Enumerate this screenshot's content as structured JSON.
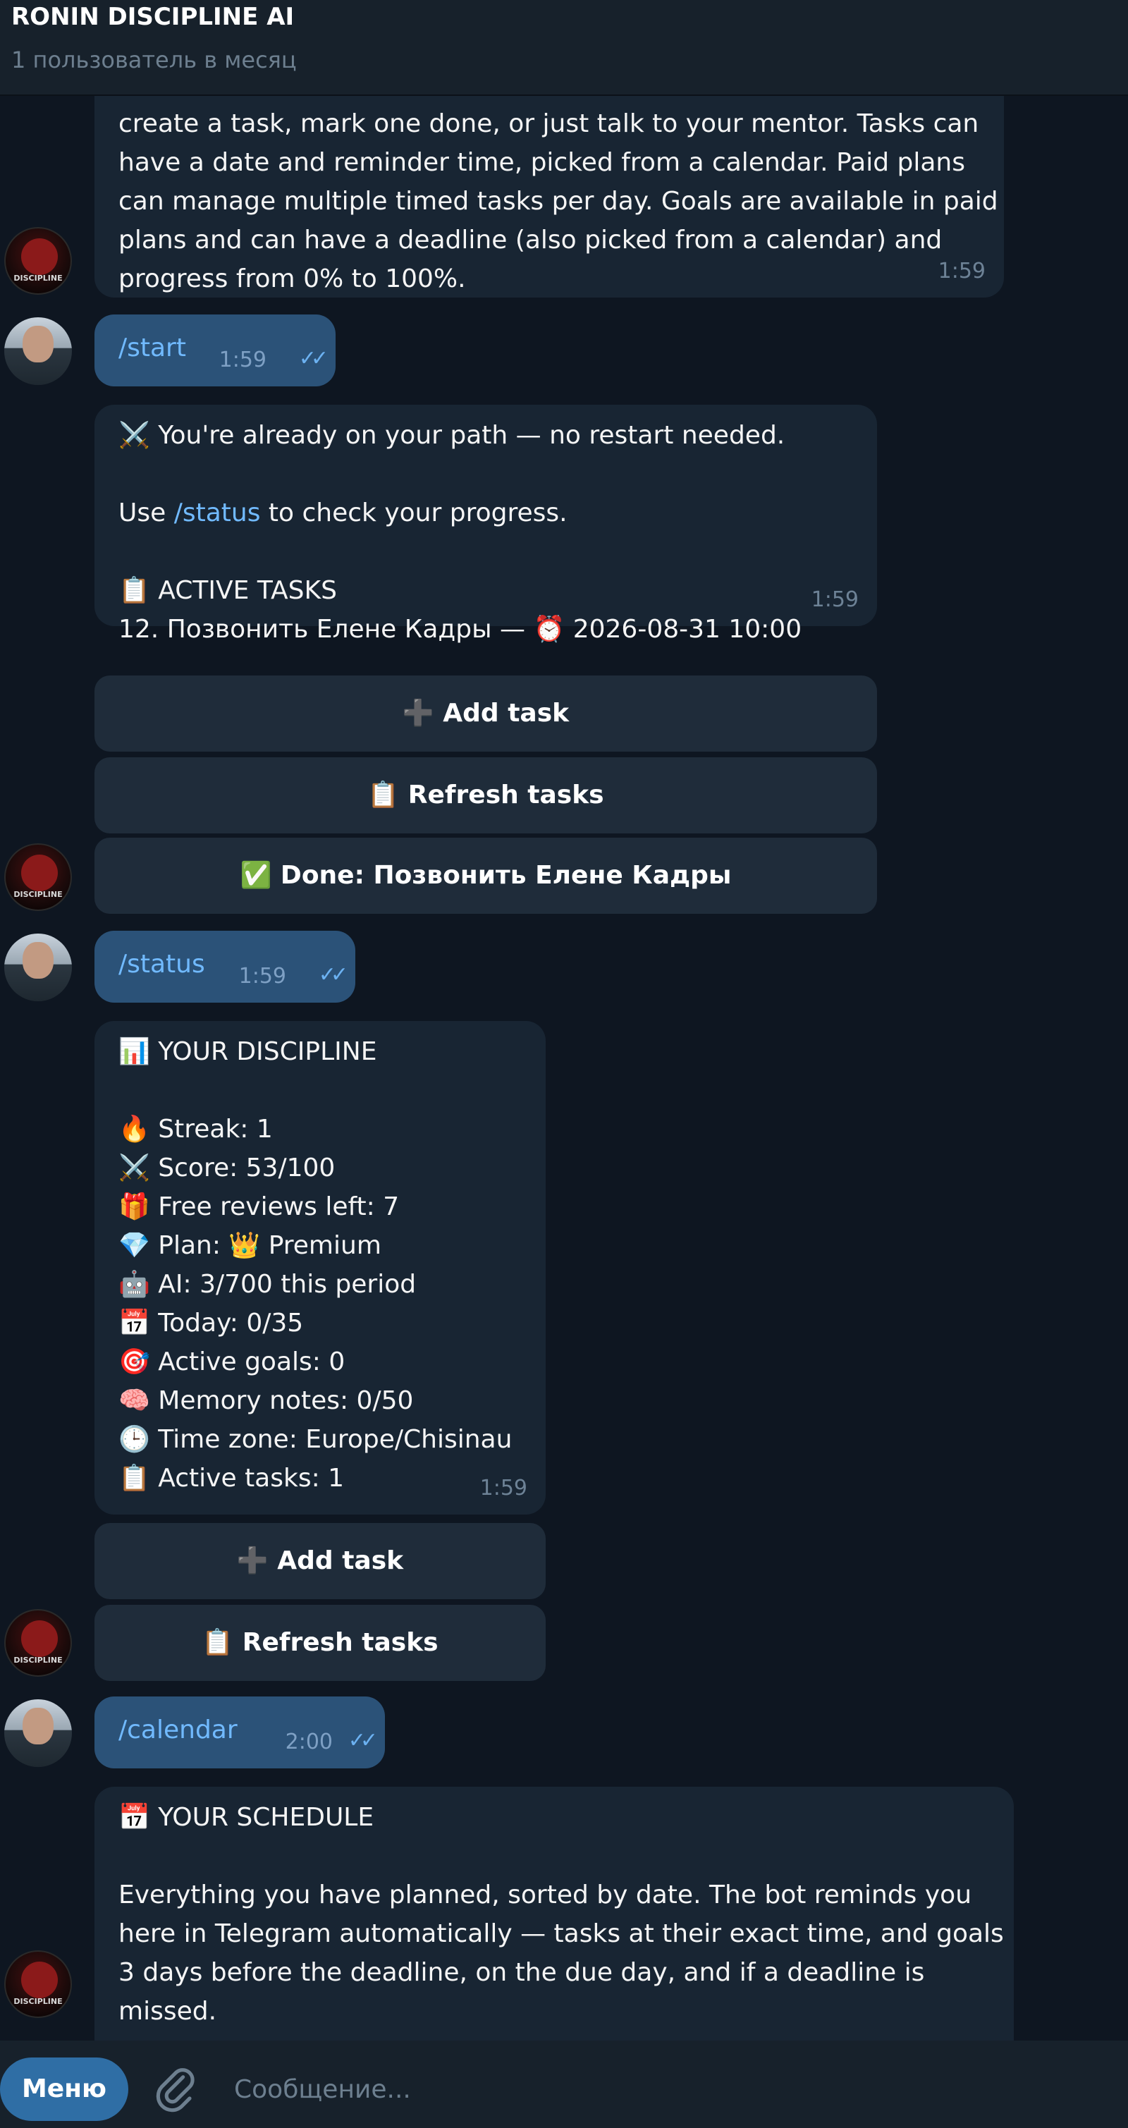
{
  "header": {
    "title": "RONIN DISCIPLINE AI",
    "subtitle": "1 пользователь в месяц"
  },
  "avatars": {
    "bot_logo_text": "DISCIPLINE"
  },
  "messages": {
    "intro": {
      "lines": [
        "create a task, mark one done, or just talk to your mentor. Tasks can",
        "have a date and reminder time, picked from a calendar. Paid plans",
        "can manage multiple timed tasks per day. Goals are available in paid",
        "plans and can have a deadline (also picked from a calendar) and",
        "progress from 0% to 100%."
      ],
      "time": "1:59"
    },
    "start_cmd": {
      "text": "/start",
      "time": "1:59",
      "checks": "✓✓"
    },
    "start_reply": {
      "line1": "⚔️ You're already on your path — no restart needed.",
      "line2_prefix": "Use ",
      "line2_link": "/status",
      "line2_suffix": " to check your progress.",
      "line3": "📋 ACTIVE TASKS",
      "line4": "12. Позвонить Елене Кадры — ⏰ 2026-08-31 10:00",
      "time": "1:59"
    },
    "start_buttons": {
      "add_task": "➕ Add task",
      "refresh_tasks": "📋 Refresh tasks",
      "done_task": "✅ Done: Позвонить Елене Кадры"
    },
    "status_cmd": {
      "text": "/status",
      "time": "1:59",
      "checks": "✓✓"
    },
    "status_reply": {
      "title": "📊 YOUR DISCIPLINE",
      "items": [
        "🔥 Streak: 1",
        "⚔️ Score: 53/100",
        "🎁 Free reviews left: 7",
        "💎 Plan: 👑 Premium",
        "🤖 AI: 3/700 this period",
        "📅 Today: 0/35",
        "🎯 Active goals: 0",
        "🧠 Memory notes: 0/50",
        "🕒 Time zone: Europe/Chisinau",
        "📋 Active tasks: 1"
      ],
      "time": "1:59"
    },
    "status_buttons": {
      "add_task": "➕ Add task",
      "refresh_tasks": "📋 Refresh tasks"
    },
    "calendar_cmd": {
      "text": "/calendar",
      "time": "2:00",
      "checks": "✓✓"
    },
    "calendar_reply": {
      "title": "📅 YOUR SCHEDULE",
      "lines": [
        "Everything you have planned, sorted by date. The bot reminds you",
        "here in Telegram automatically — tasks at their exact time, and goals",
        "3 days before the deadline, on the due day, and if a deadline is",
        "missed."
      ]
    }
  },
  "composer": {
    "menu_label": "Меню",
    "placeholder": "Сообщение..."
  }
}
